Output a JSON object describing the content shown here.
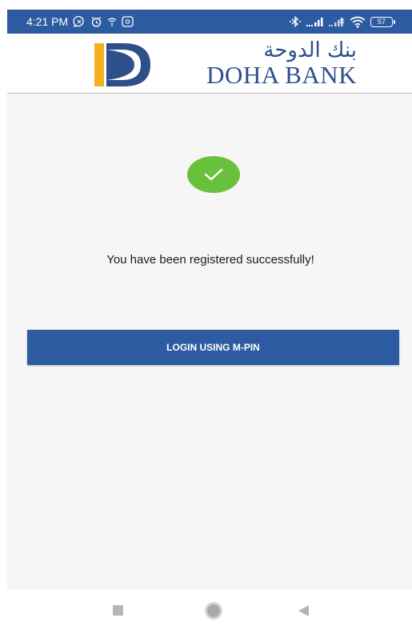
{
  "status_bar": {
    "time": "4:21 PM",
    "battery_level": "57",
    "background_color": "#2d5ba1",
    "icons": [
      "whatsapp-icon",
      "alarm-icon",
      "wifi-calling-icon",
      "media-icon",
      "bluetooth-icon",
      "signal-icon",
      "signal-icon-2",
      "wifi-icon",
      "battery-icon"
    ]
  },
  "header": {
    "logo_arabic": "بنك الدوحة",
    "logo_english": "DOHA BANK",
    "brand_color": "#2e4f8a",
    "logo_accent_color": "#f2b01e"
  },
  "content": {
    "success_icon": "checkmark-icon",
    "success_color": "#69c13b",
    "message": "You have been registered successfully!"
  },
  "actions": {
    "login_label": "LOGIN USING M-PIN",
    "button_color": "#2d5ba1"
  },
  "navigation": {
    "buttons": [
      "recent-apps",
      "home",
      "back"
    ]
  }
}
